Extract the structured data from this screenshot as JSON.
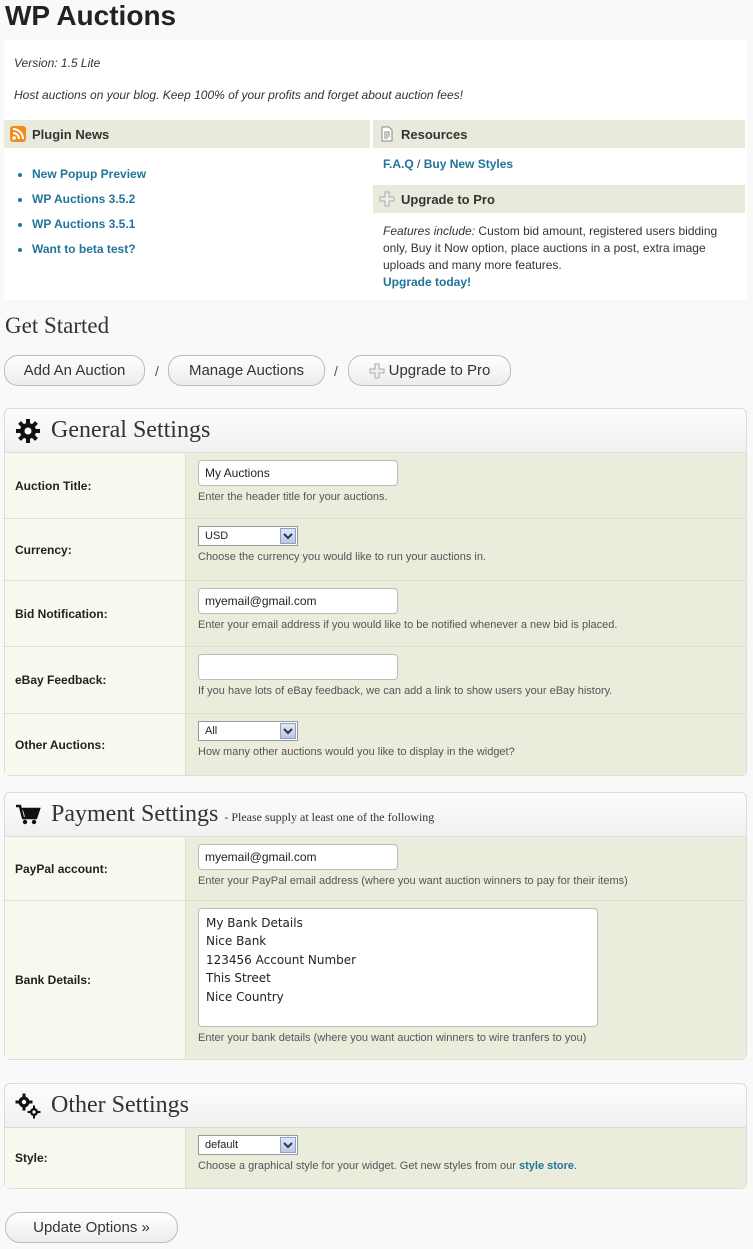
{
  "page_title": "WP Auctions",
  "info": {
    "version": "Version: 1.5 Lite",
    "tagline": "Host auctions on your blog. Keep 100% of your profits and forget about auction fees!",
    "plugin_news_heading": "Plugin News",
    "news_items": [
      "New Popup Preview",
      "WP Auctions 3.5.2",
      "WP Auctions 3.5.1",
      "Want to beta test?"
    ],
    "resources_heading": "Resources",
    "faq_link": "F.A.Q",
    "separator": "/",
    "buy_styles_link": "Buy New Styles",
    "upgrade_heading": "Upgrade to Pro",
    "features_label": "Features include:",
    "features_text": " Custom bid amount, registered users bidding only, Buy it Now option, place auctions in a post, extra image uploads and many more features.",
    "upgrade_link": "Upgrade today!"
  },
  "get_started": {
    "heading": "Get Started",
    "add_auction": "Add An Auction",
    "manage_auctions": "Manage Auctions",
    "upgrade_pro": "Upgrade to Pro",
    "slash": "/"
  },
  "general": {
    "title": "General Settings",
    "auction_title_label": "Auction Title:",
    "auction_title_value": "My Auctions",
    "auction_title_help": "Enter the header title for your auctions.",
    "currency_label": "Currency:",
    "currency_value": "USD",
    "currency_help": "Choose the currency you would like to run your auctions in.",
    "bid_label": "Bid Notification:",
    "bid_value": "myemail@gmail.com",
    "bid_help": "Enter your email address if you would like to be notified whenever a new bid is placed.",
    "ebay_label": "eBay Feedback:",
    "ebay_value": "",
    "ebay_help": "If you have lots of eBay feedback, we can add a link to show users your eBay history.",
    "other_label": "Other Auctions:",
    "other_value": "All",
    "other_help": "How many other auctions would you like to display in the widget?"
  },
  "payment": {
    "title": "Payment Settings",
    "note": "- Please supply at least one of the following",
    "paypal_label": "PayPal account:",
    "paypal_value": "myemail@gmail.com",
    "paypal_help": "Enter your PayPal email address (where you want auction winners to pay for their items)",
    "bank_label": "Bank Details:",
    "bank_value": "My Bank Details\nNice Bank\n123456 Account Number\nThis Street\nNice Country",
    "bank_help": "Enter your bank details (where you want auction winners to wire tranfers to you)"
  },
  "other": {
    "title": "Other Settings",
    "style_label": "Style:",
    "style_value": "default",
    "style_help_prefix": "Choose a graphical style for your widget. Get new styles from our ",
    "style_store_link": "style store",
    "style_help_suffix": "."
  },
  "update_button": "Update Options »",
  "colors": {
    "link": "#21759b",
    "panel_bg": "#ececdc",
    "label_bg": "#f8faef"
  }
}
